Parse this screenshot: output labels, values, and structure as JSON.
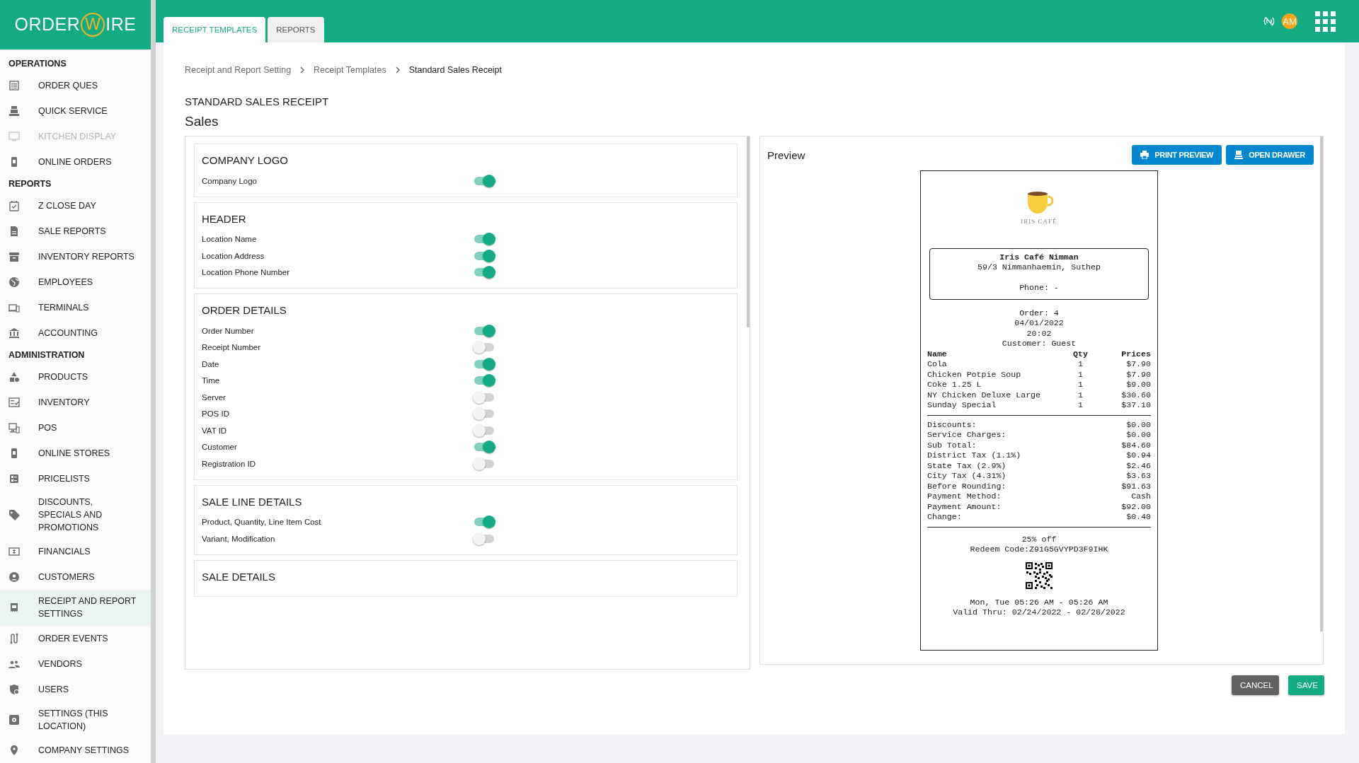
{
  "logo": {
    "text_start": "ORDER",
    "emblem": "W",
    "text_end": "IRE"
  },
  "sidebar": {
    "sections": [
      {
        "title": "OPERATIONS",
        "items": [
          {
            "label": "ORDER QUES",
            "selected": false,
            "disabled": false
          },
          {
            "label": "QUICK SERVICE",
            "selected": false,
            "disabled": false
          },
          {
            "label": "KITCHEN DISPLAY",
            "selected": false,
            "disabled": true
          },
          {
            "label": "ONLINE ORDERS",
            "selected": false,
            "disabled": false
          }
        ]
      },
      {
        "title": "REPORTS",
        "items": [
          {
            "label": "Z CLOSE DAY",
            "selected": false,
            "disabled": false
          },
          {
            "label": "SALE REPORTS",
            "selected": false,
            "disabled": false
          },
          {
            "label": "INVENTORY REPORTS",
            "selected": false,
            "disabled": false
          },
          {
            "label": "EMPLOYEES",
            "selected": false,
            "disabled": false
          },
          {
            "label": "TERMINALS",
            "selected": false,
            "disabled": false
          },
          {
            "label": "ACCOUNTING",
            "selected": false,
            "disabled": false
          }
        ]
      },
      {
        "title": "ADMINISTRATION",
        "items": [
          {
            "label": "PRODUCTS",
            "selected": false,
            "disabled": false
          },
          {
            "label": "INVENTORY",
            "selected": false,
            "disabled": false
          },
          {
            "label": "POS",
            "selected": false,
            "disabled": false
          },
          {
            "label": "ONLINE STORES",
            "selected": false,
            "disabled": false
          },
          {
            "label": "PRICELISTS",
            "selected": false,
            "disabled": false
          },
          {
            "label": "DISCOUNTS, SPECIALS AND PROMOTIONS",
            "selected": false,
            "disabled": false
          },
          {
            "label": "FINANCIALS",
            "selected": false,
            "disabled": false
          },
          {
            "label": "CUSTOMERS",
            "selected": false,
            "disabled": false
          },
          {
            "label": "RECEIPT AND REPORT SETTINGS",
            "selected": true,
            "disabled": false
          },
          {
            "label": "ORDER EVENTS",
            "selected": false,
            "disabled": false
          },
          {
            "label": "VENDORS",
            "selected": false,
            "disabled": false
          },
          {
            "label": "USERS",
            "selected": false,
            "disabled": false
          },
          {
            "label": "SETTINGS (THIS LOCATION)",
            "selected": false,
            "disabled": false
          },
          {
            "label": "COMPANY SETTINGS",
            "selected": false,
            "disabled": false
          }
        ]
      }
    ]
  },
  "tabs": [
    {
      "label": "RECEIPT TEMPLATES",
      "selected": true
    },
    {
      "label": "REPORTS",
      "selected": false
    }
  ],
  "top_bar": {
    "avatar": "AM"
  },
  "breadcrumb": [
    "Receipt and Report Setting",
    "Receipt Templates",
    "Standard Sales Receipt"
  ],
  "page_title": "STANDARD SALES RECEIPT",
  "subtitle": "Sales",
  "settings": [
    {
      "title": "COMPANY LOGO",
      "options": [
        {
          "label": "Company Logo",
          "on": true
        }
      ]
    },
    {
      "title": "HEADER",
      "options": [
        {
          "label": "Location Name",
          "on": true
        },
        {
          "label": "Location Address",
          "on": true
        },
        {
          "label": "Location Phone Number",
          "on": true
        }
      ]
    },
    {
      "title": "ORDER DETAILS",
      "options": [
        {
          "label": "Order Number",
          "on": true
        },
        {
          "label": "Receipt Number",
          "on": false
        },
        {
          "label": "Date",
          "on": true
        },
        {
          "label": "Time",
          "on": true
        },
        {
          "label": "Server",
          "on": false
        },
        {
          "label": "POS ID",
          "on": false
        },
        {
          "label": "VAT ID",
          "on": false
        },
        {
          "label": "Customer",
          "on": true
        },
        {
          "label": "Registration ID",
          "on": false
        }
      ]
    },
    {
      "title": "SALE LINE DETAILS",
      "options": [
        {
          "label": "Product, Quantity, Line Item Cost",
          "on": true
        },
        {
          "label": "Variant, Modification",
          "on": false
        }
      ]
    },
    {
      "title": "SALE DETAILS"
    }
  ],
  "preview": {
    "title": "Preview",
    "buttons": [
      "PRINT PREVIEW",
      "OPEN DRAWER"
    ],
    "receipt": {
      "logo_caption": "IRIS CAFÉ",
      "store_name": "Iris Café Nimman",
      "address": "59/3 Nimmanhaemin, Suthep",
      "phone": "Phone: -",
      "order_lines": [
        "Order: 4",
        "04/01/2022",
        "20:02",
        "Customer: Guest"
      ],
      "columns": [
        "Name",
        "Qty",
        "Prices"
      ],
      "items": [
        {
          "name": "Cola",
          "qty": "1",
          "price": "$7.90"
        },
        {
          "name": "Chicken Potpie Soup",
          "qty": "1",
          "price": "$7.90"
        },
        {
          "name": "Coke 1.25 L",
          "qty": "1",
          "price": "$9.00"
        },
        {
          "name": "NY Chicken Deluxe Large",
          "qty": "1",
          "price": "$30.60"
        },
        {
          "name": "Sunday Special",
          "qty": "1",
          "price": "$37.10"
        }
      ],
      "totals": [
        {
          "label": "Discounts:",
          "value": "$0.00"
        },
        {
          "label": "Service Charges:",
          "value": "$0.00"
        },
        {
          "label": "Sub Total:",
          "value": "$84.60"
        },
        {
          "label": "District Tax (1.1%)",
          "value": "$0.94"
        },
        {
          "label": "State Tax (2.9%)",
          "value": "$2.46"
        },
        {
          "label": "City Tax (4.31%)",
          "value": "$3.63"
        },
        {
          "label": "Before Rounding:",
          "value": "$91.63"
        },
        {
          "label": "Payment Method:",
          "value": "Cash"
        },
        {
          "label": "Payment Amount:",
          "value": "$92.00"
        },
        {
          "label": "Change:",
          "value": "$0.40"
        }
      ],
      "promo": [
        "25% off",
        "Redeem Code:Z91G5GVYPD3F9IHK"
      ],
      "validity": [
        "Mon, Tue 05:26 AM - 05:26 AM",
        "Valid Thru: 02/24/2022 - 02/28/2022"
      ]
    }
  },
  "actions": [
    {
      "label": "CANCEL",
      "kind": "secondary"
    },
    {
      "label": "SAVE",
      "kind": "primary"
    }
  ]
}
